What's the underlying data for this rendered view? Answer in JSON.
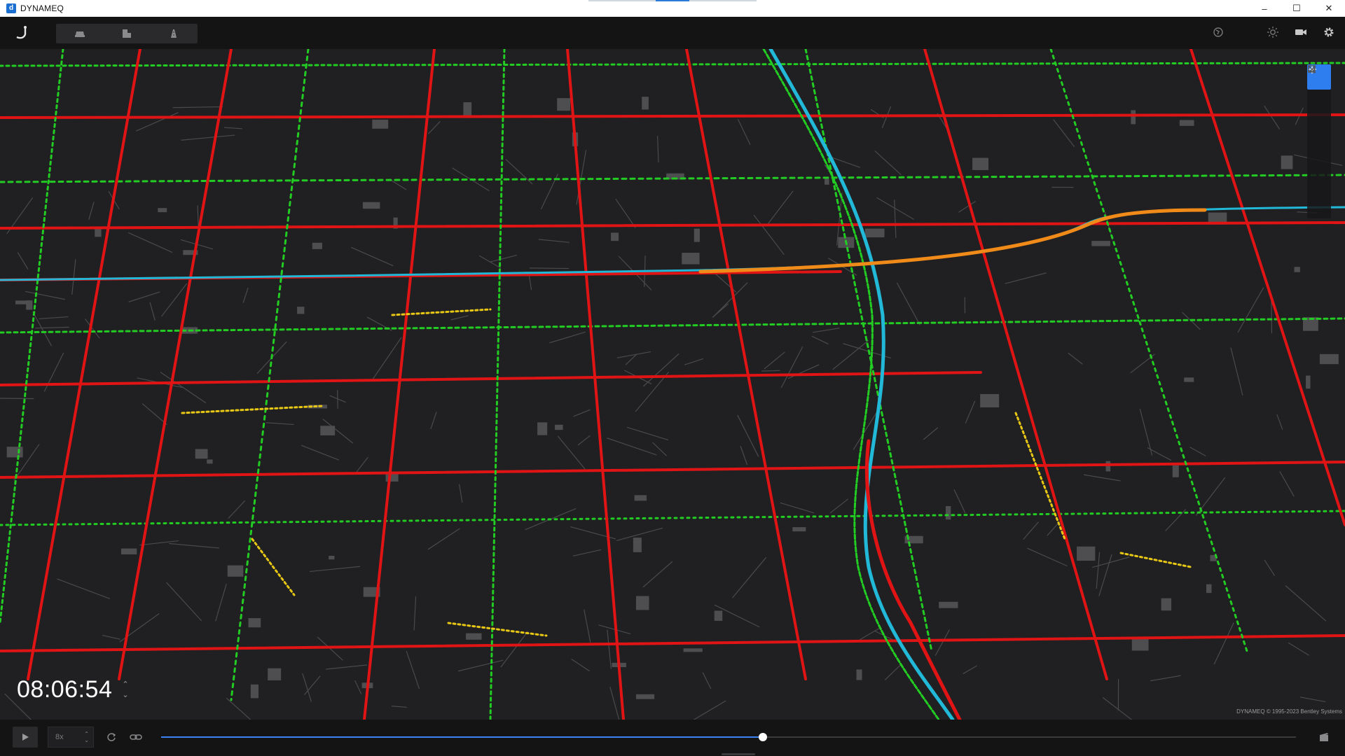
{
  "window": {
    "title": "DYNAMEQ",
    "logo_letter": "d",
    "controls": {
      "minimize": "–",
      "maximize": "☐",
      "close": "✕"
    }
  },
  "toolbar": {
    "home_icon": "dynameq-logo-icon",
    "group_icons": [
      "vehicle-icon",
      "building-icon",
      "road-icon"
    ],
    "right_icons": [
      "globe-icon",
      "sun-icon",
      "camera-icon",
      "gear-icon"
    ]
  },
  "side_tools": {
    "icons": [
      "move-crosshair-icon",
      "select-box-icon",
      "select-plus-icon",
      "pen-icon",
      "select-minus-icon",
      "fit-icon"
    ],
    "active_index": 0
  },
  "clock": {
    "time": "08:06:54"
  },
  "copyright": "DYNAMEQ © 1995-2023 Bentley Systems",
  "playback": {
    "speed": "8x",
    "progress": 0.53
  },
  "colors": {
    "accent": "#3b82f6",
    "congested": "#e01414",
    "moderate": "#e8c814",
    "free_flow": "#22cc22",
    "freeway": "#22b8d8",
    "base_map": "#202022"
  }
}
